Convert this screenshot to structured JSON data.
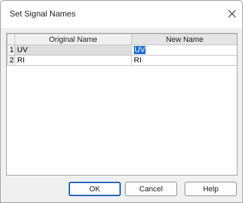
{
  "window": {
    "title": "Set Signal Names"
  },
  "grid": {
    "headers": {
      "original": "Original Name",
      "new": "New Name"
    },
    "rows": [
      {
        "num": "1",
        "original": "UV",
        "new": "UV",
        "selected": true
      },
      {
        "num": "2",
        "original": "RI",
        "new": "RI",
        "selected": false
      }
    ]
  },
  "buttons": {
    "ok": "OK",
    "cancel": "Cancel",
    "help": "Help"
  },
  "icons": {
    "close": "close-icon"
  },
  "colors": {
    "selection": "#1e6fd0",
    "default_button_border": "#1a5fb4"
  }
}
